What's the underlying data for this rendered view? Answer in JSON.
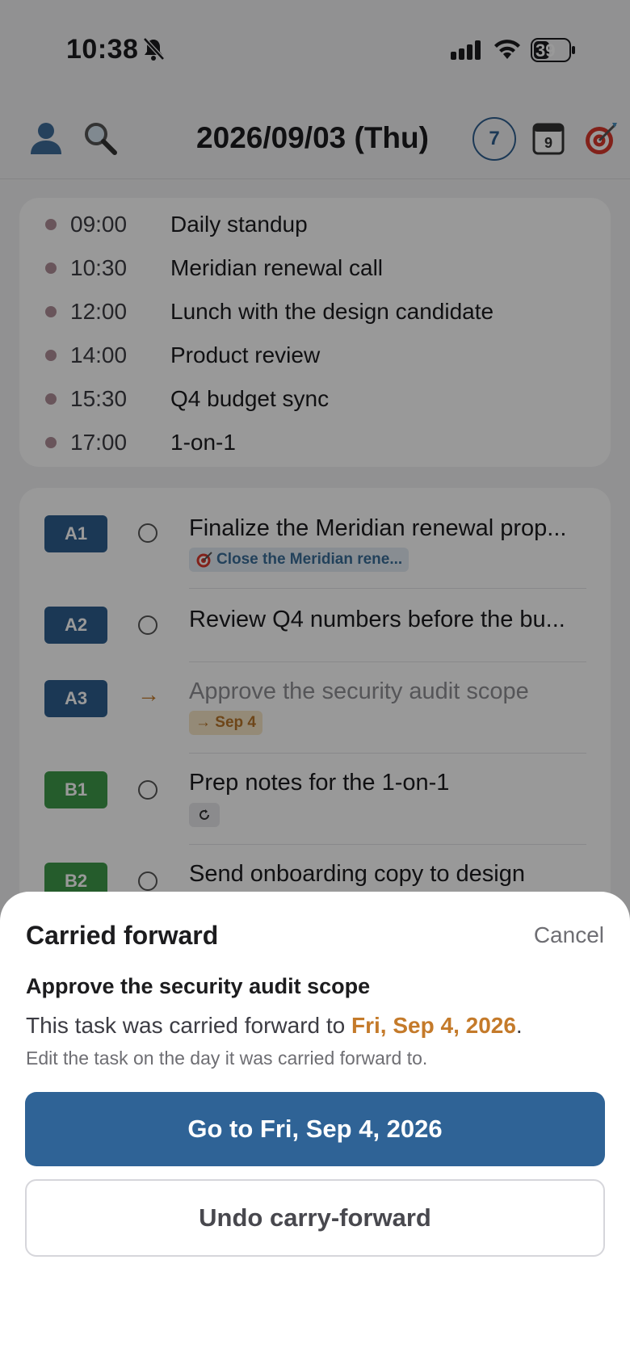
{
  "status_bar": {
    "time": "10:38",
    "battery": "39"
  },
  "header": {
    "date_title": "2026/09/03 (Thu)",
    "week_number": "7",
    "calendar_day": "9"
  },
  "schedule": [
    {
      "time": "09:00",
      "title": "Daily standup"
    },
    {
      "time": "10:30",
      "title": "Meridian renewal call"
    },
    {
      "time": "12:00",
      "title": "Lunch with the design candidate"
    },
    {
      "time": "14:00",
      "title": "Product review"
    },
    {
      "time": "15:30",
      "title": "Q4 budget sync"
    },
    {
      "time": "17:00",
      "title": "1-on-1"
    }
  ],
  "tasks": [
    {
      "priority": "A1",
      "title": "Finalize the Meridian renewal prop...",
      "goal_chip": "Close the Meridian rene..."
    },
    {
      "priority": "A2",
      "title": "Review Q4 numbers before the bu..."
    },
    {
      "priority": "A3",
      "title": "Approve the security audit scope",
      "status_icon": "→",
      "date_chip": "→ Sep 4"
    },
    {
      "priority": "B1",
      "title": "Prep notes for the 1-on-1"
    },
    {
      "priority": "B2",
      "title": "Send onboarding copy to design"
    }
  ],
  "sheet": {
    "title": "Carried forward",
    "cancel": "Cancel",
    "task_name": "Approve the security audit scope",
    "message_prefix": "This task was carried forward to ",
    "message_date": "Fri, Sep 4, 2026",
    "message_suffix": ".",
    "hint": "Edit the task on the day it was carried forward to.",
    "primary_button": "Go to Fri, Sep 4, 2026",
    "secondary_button": "Undo carry-forward"
  },
  "colors": {
    "accent": "#2f6396",
    "highlight": "#c47a2a",
    "priority_a": "#2d5e8e",
    "priority_b": "#3f9a4a"
  }
}
